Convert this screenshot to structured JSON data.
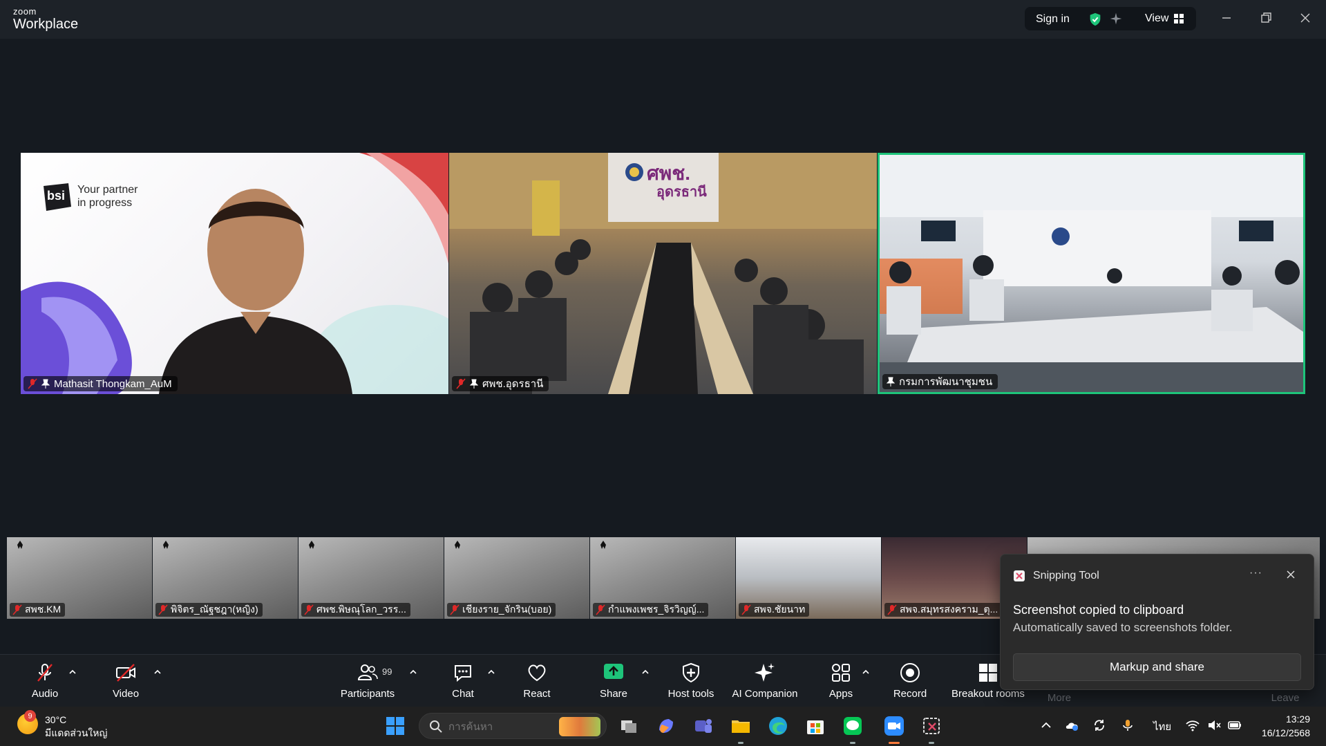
{
  "titlebar": {
    "brand_small": "zoom",
    "brand_big": "Workplace",
    "signin_label": "Sign in",
    "view_label": "View",
    "icons": [
      "shield-check-icon",
      "sparkle-icon",
      "grid-icon",
      "minimize-icon",
      "restore-icon",
      "close-icon"
    ]
  },
  "main_tiles": [
    {
      "name": "Mathasit Thongkam_AuM",
      "muted": true,
      "pinned": true,
      "logo_text": "bsi",
      "tagline_1": "Your partner",
      "tagline_2": "in progress"
    },
    {
      "name": "ศพช.อุดรธานี",
      "muted": true,
      "pinned": true,
      "sign_text": "ศพช.",
      "sign_sub": "อุดรธานี"
    },
    {
      "name": "กรมการพัฒนาชุมชน",
      "muted": false,
      "pinned": true,
      "active_speaker": true
    }
  ],
  "thumbnails": [
    {
      "name": "สพช.KM"
    },
    {
      "name": "พิจิตร_ณัฐชฎา(หญิง)"
    },
    {
      "name": "ศพช.พิษณุโลก_วรร..."
    },
    {
      "name": "เชียงราย_จักริน(บอย)"
    },
    {
      "name": "กำแพงเพชร_จิรวิญญ์..."
    },
    {
      "name": "สพจ.ชัยนาท"
    },
    {
      "name": "สพจ.สมุทรสงคราม_ตุ..."
    }
  ],
  "toast": {
    "app": "Snipping Tool",
    "more": "···",
    "title": "Screenshot copied to clipboard",
    "subtitle": "Automatically saved to screenshots folder.",
    "button": "Markup and share"
  },
  "toolbar": {
    "audio": "Audio",
    "video": "Video",
    "participants": "Participants",
    "participants_count": "99",
    "chat": "Chat",
    "react": "React",
    "share": "Share",
    "host_tools": "Host tools",
    "ai_companion": "AI Companion",
    "apps": "Apps",
    "record": "Record",
    "breakout": "Breakout rooms",
    "more": "More",
    "leave": "Leave",
    "colors": {
      "share_green": "#1ec47a",
      "leave_red": "#e02828"
    }
  },
  "taskbar": {
    "weather_badge": "9",
    "temperature": "30°C",
    "weather_desc": "มีแดดส่วนใหญ่",
    "search_placeholder": "การค้นหา",
    "language": "ไทย",
    "time": "13:29",
    "date": "16/12/2568"
  }
}
